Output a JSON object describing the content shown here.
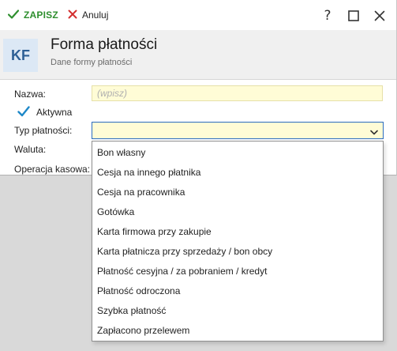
{
  "toolbar": {
    "save_label": "ZAPISZ",
    "save_icon": "check-icon",
    "cancel_label": "Anuluj",
    "cancel_icon": "close-x-icon",
    "help_glyph": "?",
    "colors": {
      "save": "#2f8f2f",
      "cancel_icon": "#d32f2f"
    }
  },
  "header": {
    "logo_text": "KF",
    "title": "Forma płatności",
    "subtitle": "Dane formy płatności"
  },
  "form": {
    "name_label": "Nazwa:",
    "name_value": "",
    "name_placeholder": "(wpisz)",
    "active_label": "Aktywna",
    "active_checked": true,
    "payment_type_label": "Typ płatności:",
    "payment_type_value": "",
    "currency_label": "Waluta:",
    "cash_operation_label": "Operacja kasowa:"
  },
  "dropdown": {
    "options": [
      "Bon własny",
      "Cesja na innego płatnika",
      "Cesja na pracownika",
      "Gotówka",
      "Karta firmowa przy zakupie",
      "Karta płatnicza przy sprzedaży / bon obcy",
      "Płatność cesyjna / za pobraniem / kredyt",
      "Płatność odroczona",
      "Szybka płatność",
      "Zapłacono przelewem"
    ]
  }
}
